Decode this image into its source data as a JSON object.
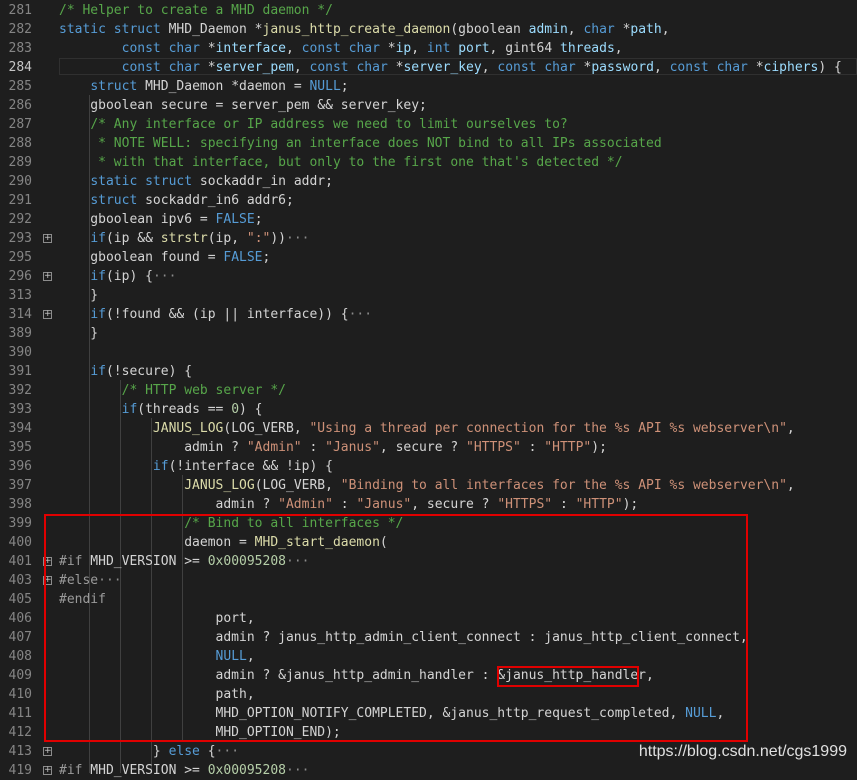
{
  "lines": [
    {
      "n": "281",
      "t": [
        [
          "/* Helper to create a MHD daemon */",
          "cm"
        ]
      ]
    },
    {
      "n": "282",
      "t": [
        [
          "static",
          "kw"
        ],
        [
          " ",
          ""
        ],
        [
          "struct",
          "kw"
        ],
        [
          " MHD_Daemon *",
          ""
        ],
        [
          "janus_http_create_daemon",
          "fn"
        ],
        [
          "(gboolean ",
          ""
        ],
        [
          "admin",
          "id"
        ],
        [
          ", ",
          ""
        ],
        [
          "char",
          "kw"
        ],
        [
          " *",
          ""
        ],
        [
          "path",
          "id"
        ],
        [
          ",",
          ""
        ]
      ]
    },
    {
      "n": "283",
      "t": [
        [
          "        ",
          ""
        ],
        [
          "const",
          "kw"
        ],
        [
          " ",
          ""
        ],
        [
          "char",
          "kw"
        ],
        [
          " *",
          ""
        ],
        [
          "interface",
          "id"
        ],
        [
          ", ",
          ""
        ],
        [
          "const",
          "kw"
        ],
        [
          " ",
          ""
        ],
        [
          "char",
          "kw"
        ],
        [
          " *",
          ""
        ],
        [
          "ip",
          "id"
        ],
        [
          ", ",
          ""
        ],
        [
          "int",
          "kw"
        ],
        [
          " ",
          ""
        ],
        [
          "port",
          "id"
        ],
        [
          ", gint64 ",
          ""
        ],
        [
          "threads",
          "id"
        ],
        [
          ",",
          ""
        ]
      ]
    },
    {
      "n": "284",
      "active": true,
      "t": [
        [
          "        ",
          ""
        ],
        [
          "const",
          "kw"
        ],
        [
          " ",
          ""
        ],
        [
          "char",
          "kw"
        ],
        [
          " *",
          ""
        ],
        [
          "server_pem",
          "id"
        ],
        [
          ", ",
          ""
        ],
        [
          "const",
          "kw"
        ],
        [
          " ",
          ""
        ],
        [
          "char",
          "kw"
        ],
        [
          " *",
          ""
        ],
        [
          "server_key",
          "id"
        ],
        [
          ", ",
          ""
        ],
        [
          "const",
          "kw"
        ],
        [
          " ",
          ""
        ],
        [
          "char",
          "kw"
        ],
        [
          " *",
          ""
        ],
        [
          "password",
          "id"
        ],
        [
          ", ",
          ""
        ],
        [
          "const",
          "kw"
        ],
        [
          " ",
          ""
        ],
        [
          "char",
          "kw"
        ],
        [
          " *",
          ""
        ],
        [
          "ciphers",
          "id"
        ],
        [
          ") {",
          ""
        ]
      ]
    },
    {
      "n": "285",
      "t": [
        [
          "    ",
          ""
        ],
        [
          "struct",
          "kw"
        ],
        [
          " MHD_Daemon *daemon = ",
          ""
        ],
        [
          "NULL",
          "kw"
        ],
        [
          ";",
          ""
        ]
      ]
    },
    {
      "n": "286",
      "t": [
        [
          "    gboolean secure = server_pem && server_key;",
          ""
        ]
      ]
    },
    {
      "n": "287",
      "t": [
        [
          "    ",
          ""
        ],
        [
          "/* Any interface or IP address we need to limit ourselves to?",
          "cm"
        ]
      ]
    },
    {
      "n": "288",
      "t": [
        [
          "     ",
          ""
        ],
        [
          "* NOTE WELL: specifying an interface does NOT bind to all IPs associated",
          "cm"
        ]
      ]
    },
    {
      "n": "289",
      "t": [
        [
          "     ",
          ""
        ],
        [
          "* with that interface, but only to the first one that's detected */",
          "cm"
        ]
      ]
    },
    {
      "n": "290",
      "t": [
        [
          "    ",
          ""
        ],
        [
          "static",
          "kw"
        ],
        [
          " ",
          ""
        ],
        [
          "struct",
          "kw"
        ],
        [
          " sockaddr_in addr;",
          ""
        ]
      ]
    },
    {
      "n": "291",
      "t": [
        [
          "    ",
          ""
        ],
        [
          "struct",
          "kw"
        ],
        [
          " sockaddr_in6 addr6;",
          ""
        ]
      ]
    },
    {
      "n": "292",
      "t": [
        [
          "    gboolean ipv6 = ",
          ""
        ],
        [
          "FALSE",
          "kw"
        ],
        [
          ";",
          ""
        ]
      ]
    },
    {
      "n": "293",
      "fold": "+",
      "t": [
        [
          "    ",
          ""
        ],
        [
          "if",
          "kw"
        ],
        [
          "(ip && ",
          ""
        ],
        [
          "strstr",
          "fn"
        ],
        [
          "(ip, ",
          ""
        ],
        [
          "\":\"",
          "str"
        ],
        [
          "))",
          ""
        ],
        [
          "···",
          "ell"
        ]
      ]
    },
    {
      "n": "295",
      "t": [
        [
          "    gboolean found = ",
          ""
        ],
        [
          "FALSE",
          "kw"
        ],
        [
          ";",
          ""
        ]
      ]
    },
    {
      "n": "296",
      "fold": "+",
      "t": [
        [
          "    ",
          ""
        ],
        [
          "if",
          "kw"
        ],
        [
          "(ip) {",
          ""
        ],
        [
          "···",
          "ell"
        ]
      ]
    },
    {
      "n": "313",
      "t": [
        [
          "    }",
          ""
        ]
      ]
    },
    {
      "n": "314",
      "fold": "+",
      "t": [
        [
          "    ",
          ""
        ],
        [
          "if",
          "kw"
        ],
        [
          "(!found && (ip || interface)) {",
          ""
        ],
        [
          "···",
          "ell"
        ]
      ]
    },
    {
      "n": "389",
      "t": [
        [
          "    }",
          ""
        ]
      ]
    },
    {
      "n": "390",
      "t": [
        [
          "",
          ""
        ]
      ]
    },
    {
      "n": "391",
      "t": [
        [
          "    ",
          ""
        ],
        [
          "if",
          "kw"
        ],
        [
          "(!secure) {",
          ""
        ]
      ]
    },
    {
      "n": "392",
      "t": [
        [
          "        ",
          ""
        ],
        [
          "/* HTTP web server */",
          "cm"
        ]
      ]
    },
    {
      "n": "393",
      "t": [
        [
          "        ",
          ""
        ],
        [
          "if",
          "kw"
        ],
        [
          "(threads == ",
          ""
        ],
        [
          "0",
          "num"
        ],
        [
          ") {",
          ""
        ]
      ]
    },
    {
      "n": "394",
      "t": [
        [
          "            ",
          ""
        ],
        [
          "JANUS_LOG",
          "fn"
        ],
        [
          "(LOG_VERB, ",
          ""
        ],
        [
          "\"Using a thread per connection for the %s API %s webserver\\n\"",
          "str"
        ],
        [
          ",",
          ""
        ]
      ]
    },
    {
      "n": "395",
      "t": [
        [
          "                admin ? ",
          ""
        ],
        [
          "\"Admin\"",
          "str"
        ],
        [
          " : ",
          ""
        ],
        [
          "\"Janus\"",
          "str"
        ],
        [
          ", secure ? ",
          ""
        ],
        [
          "\"HTTPS\"",
          "str"
        ],
        [
          " : ",
          ""
        ],
        [
          "\"HTTP\"",
          "str"
        ],
        [
          ");",
          ""
        ]
      ]
    },
    {
      "n": "396",
      "t": [
        [
          "            ",
          ""
        ],
        [
          "if",
          "kw"
        ],
        [
          "(!interface && !ip) {",
          ""
        ]
      ]
    },
    {
      "n": "397",
      "t": [
        [
          "                ",
          ""
        ],
        [
          "JANUS_LOG",
          "fn"
        ],
        [
          "(LOG_VERB, ",
          ""
        ],
        [
          "\"Binding to all interfaces for the %s API %s webserver\\n\"",
          "str"
        ],
        [
          ",",
          ""
        ]
      ]
    },
    {
      "n": "398",
      "t": [
        [
          "                    admin ? ",
          ""
        ],
        [
          "\"Admin\"",
          "str"
        ],
        [
          " : ",
          ""
        ],
        [
          "\"Janus\"",
          "str"
        ],
        [
          ", secure ? ",
          ""
        ],
        [
          "\"HTTPS\"",
          "str"
        ],
        [
          " : ",
          ""
        ],
        [
          "\"HTTP\"",
          "str"
        ],
        [
          ");",
          ""
        ]
      ]
    },
    {
      "n": "399",
      "t": [
        [
          "                ",
          ""
        ],
        [
          "/* Bind to all interfaces */",
          "cm"
        ]
      ]
    },
    {
      "n": "400",
      "t": [
        [
          "                daemon = ",
          ""
        ],
        [
          "MHD_start_daemon",
          "fn"
        ],
        [
          "(",
          ""
        ]
      ]
    },
    {
      "n": "401",
      "fold": "+",
      "t": [
        [
          "#if",
          "pp"
        ],
        [
          " MHD_VERSION >= ",
          ""
        ],
        [
          "0x00095208",
          "num"
        ],
        [
          "···",
          "ell"
        ]
      ]
    },
    {
      "n": "403",
      "fold": "+",
      "t": [
        [
          "#else",
          "pp"
        ],
        [
          "···",
          "ell"
        ]
      ]
    },
    {
      "n": "405",
      "t": [
        [
          "#endif",
          "pp"
        ]
      ]
    },
    {
      "n": "406",
      "t": [
        [
          "                    port,",
          ""
        ]
      ]
    },
    {
      "n": "407",
      "t": [
        [
          "                    admin ? janus_http_admin_client_connect : janus_http_client_connect,",
          ""
        ]
      ]
    },
    {
      "n": "408",
      "t": [
        [
          "                    ",
          ""
        ],
        [
          "NULL",
          "kw"
        ],
        [
          ",",
          ""
        ]
      ]
    },
    {
      "n": "409",
      "t": [
        [
          "                    admin ? &janus_http_admin_handler : &janus_http_handler,",
          ""
        ]
      ]
    },
    {
      "n": "410",
      "t": [
        [
          "                    path,",
          ""
        ]
      ]
    },
    {
      "n": "411",
      "t": [
        [
          "                    MHD_OPTION_NOTIFY_COMPLETED, &janus_http_request_completed, ",
          ""
        ],
        [
          "NULL",
          "kw"
        ],
        [
          ",",
          ""
        ]
      ]
    },
    {
      "n": "412",
      "t": [
        [
          "                    MHD_OPTION_END);",
          ""
        ]
      ]
    },
    {
      "n": "413",
      "fold": "+",
      "t": [
        [
          "            } ",
          ""
        ],
        [
          "else",
          "kw"
        ],
        [
          " {",
          ""
        ],
        [
          "···",
          "ell"
        ]
      ]
    },
    {
      "n": "419",
      "fold": "+",
      "t": [
        [
          "#if",
          "pp"
        ],
        [
          " MHD_VERSION >= ",
          ""
        ],
        [
          "0x00095208",
          "num"
        ],
        [
          "···",
          "ell"
        ]
      ]
    }
  ],
  "watermark": "https://blog.csdn.net/cgs1999"
}
